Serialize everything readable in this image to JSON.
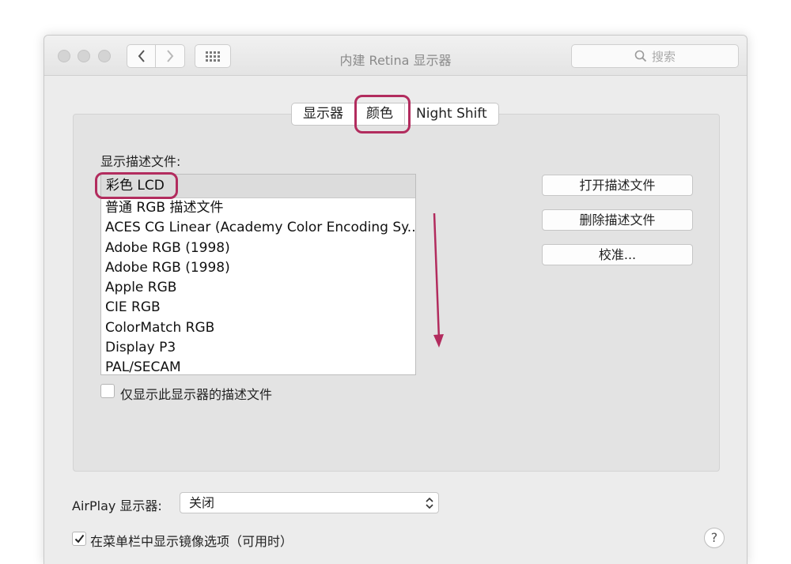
{
  "window": {
    "title": "内建 Retina 显示器",
    "search_placeholder": "搜索"
  },
  "tabs": [
    {
      "label": "显示器",
      "selected": false
    },
    {
      "label": "颜色",
      "selected": true
    },
    {
      "label": "Night Shift",
      "selected": false
    }
  ],
  "profiles": {
    "heading": "显示描述文件:",
    "selected": "彩色 LCD",
    "items": [
      "普通 RGB 描述文件",
      "ACES CG Linear (Academy Color Encoding Sy...",
      "Adobe RGB (1998)",
      "Adobe RGB (1998)",
      "Apple RGB",
      "CIE RGB",
      "ColorMatch RGB",
      "Display P3",
      "PAL/SECAM"
    ],
    "only_this_display_label": "仅显示此显示器的描述文件",
    "only_this_display_checked": false
  },
  "actions": {
    "open_label": "打开描述文件",
    "delete_label": "删除描述文件",
    "calibrate_label": "校准..."
  },
  "airplay": {
    "label": "AirPlay 显示器:",
    "value": "关闭"
  },
  "mirroring": {
    "label": "在菜单栏中显示镜像选项（可用时）",
    "checked": true
  },
  "help_label": "?",
  "colors": {
    "annotation": "#b22c5e"
  }
}
